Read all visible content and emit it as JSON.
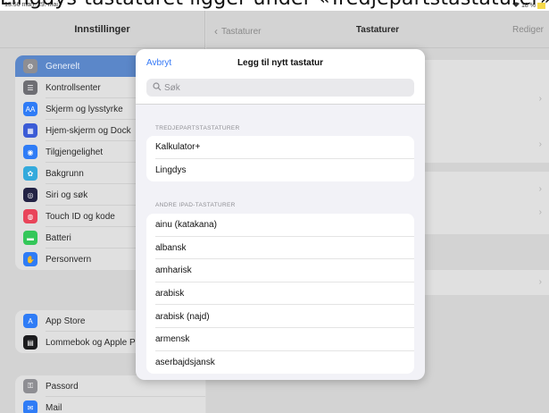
{
  "caption": "Lingdys-tastaturet ligger under «Tredjepartstastaturer»",
  "status": {
    "time": "13:56  man. 29. mai",
    "wifi": "wifi-icon",
    "right": "18 %"
  },
  "sidebar": {
    "title": "Innstillinger",
    "group1": [
      {
        "label": "Generelt",
        "icon": "gear-icon",
        "color": "#8e8e93",
        "glyph": "⚙",
        "selected": true
      },
      {
        "label": "Kontrollsenter",
        "icon": "control-center-icon",
        "color": "#6e6e73",
        "glyph": "☰"
      },
      {
        "label": "Skjerm og lysstyrke",
        "icon": "display-icon",
        "color": "#2f7cf6",
        "glyph": "AA"
      },
      {
        "label": "Hjem-skjerm og Dock",
        "icon": "home-screen-icon",
        "color": "#3b5bd6",
        "glyph": "▦"
      },
      {
        "label": "Tilgjengelighet",
        "icon": "accessibility-icon",
        "color": "#2f7cf6",
        "glyph": "◉"
      },
      {
        "label": "Bakgrunn",
        "icon": "wallpaper-icon",
        "color": "#34aadc",
        "glyph": "✿"
      },
      {
        "label": "Siri og søk",
        "icon": "siri-icon",
        "color": "#222244",
        "glyph": "◎"
      },
      {
        "label": "Touch ID og kode",
        "icon": "fingerprint-icon",
        "color": "#e9445a",
        "glyph": "◍"
      },
      {
        "label": "Batteri",
        "icon": "battery-icon",
        "color": "#34c759",
        "glyph": "▬"
      },
      {
        "label": "Personvern",
        "icon": "hand-icon",
        "color": "#2f7cf6",
        "glyph": "✋"
      }
    ],
    "group2": [
      {
        "label": "App Store",
        "icon": "app-store-icon",
        "color": "#2f7cf6",
        "glyph": "A"
      },
      {
        "label": "Lommebok og Apple Pay",
        "icon": "wallet-icon",
        "color": "#1c1c1e",
        "glyph": "▤"
      }
    ],
    "group3": [
      {
        "label": "Passord",
        "icon": "key-icon",
        "color": "#8e8e93",
        "glyph": "⚿"
      },
      {
        "label": "Mail",
        "icon": "mail-icon",
        "color": "#2f7cf6",
        "glyph": "✉"
      }
    ]
  },
  "detail": {
    "back_label": "Tastaturer",
    "title": "Tastaturer",
    "edit_label": "Rediger"
  },
  "modal": {
    "cancel_label": "Avbryt",
    "title": "Legg til nytt tastatur",
    "search_placeholder": "Søk",
    "third_party_header": "TREDJEPARTSTASTATURER",
    "third_party": [
      "Kalkulator+",
      "Lingdys"
    ],
    "other_header": "ANDRE IPAD-TASTATURER",
    "other": [
      "ainu (katakana)",
      "albansk",
      "amharisk",
      "arabisk",
      "arabisk (najd)",
      "armensk",
      "aserbajdsjansk"
    ]
  },
  "colors": {
    "accent": "#3478f6",
    "selected_row": "#5b87c9"
  }
}
